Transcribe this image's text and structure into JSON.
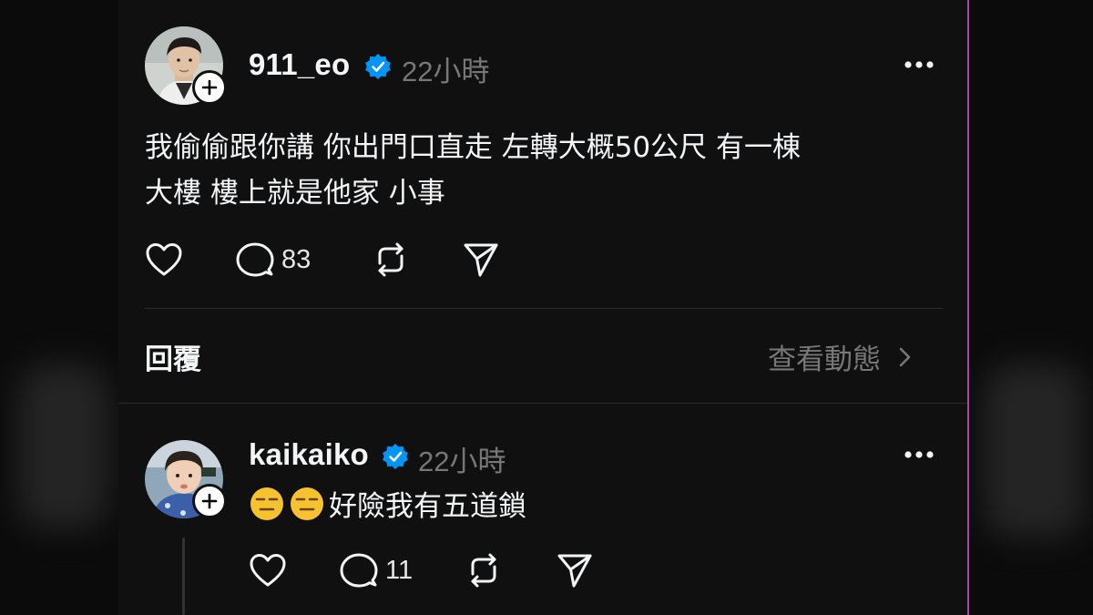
{
  "post": {
    "username": "911_eo",
    "time": "22小時",
    "text_line1": "我偷偷跟你講 你出門口直走 左轉大概50公尺 有一棟",
    "text_line2": "大樓 樓上就是他家 小事",
    "comment_count": "83"
  },
  "replies_section": {
    "title": "回覆",
    "view_activity": "查看動態"
  },
  "reply": {
    "username": "kaikaiko",
    "time": "22小時",
    "emojis": [
      "expressionless-face",
      "expressionless-face"
    ],
    "text": "好險我有五道鎖",
    "comment_count": "11"
  },
  "colors": {
    "background": "#101010",
    "text": "#f3f5f7",
    "muted": "#777777",
    "verified": "#0095f6",
    "divider": "#2b2b2b"
  }
}
